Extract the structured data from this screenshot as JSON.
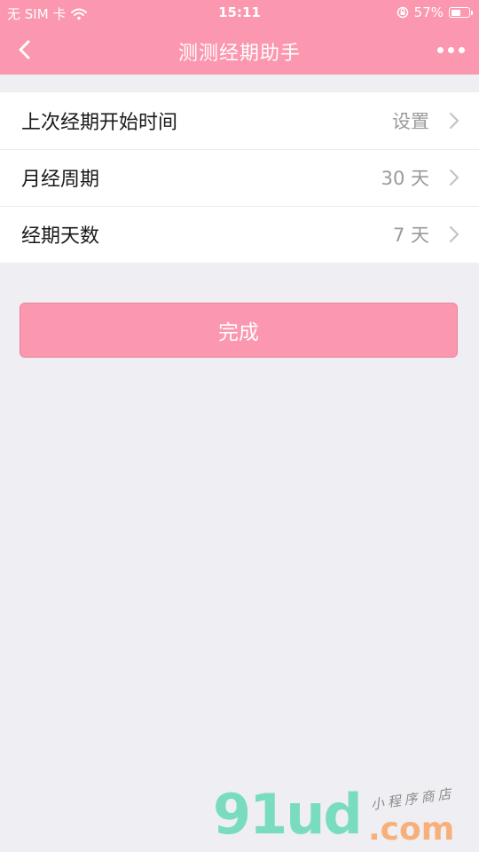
{
  "status_bar": {
    "carrier": "无 SIM 卡",
    "time": "15:11",
    "battery_percent": "57%",
    "battery_level": 0.57
  },
  "nav": {
    "title": "测测经期助手",
    "back_icon": "chevron-left-icon",
    "more_icon": "more-dots-icon"
  },
  "settings": [
    {
      "label": "上次经期开始时间",
      "value": "设置"
    },
    {
      "label": "月经周期",
      "value": "30 天"
    },
    {
      "label": "经期天数",
      "value": "7 天"
    }
  ],
  "done_button": {
    "label": "完成"
  },
  "watermark": {
    "logo": "91ud",
    "domain": ".com",
    "tagline": "小程序商店"
  },
  "colors": {
    "accent": "#fb97ae",
    "background": "#efeef2",
    "value_text": "#9a9a9a"
  }
}
